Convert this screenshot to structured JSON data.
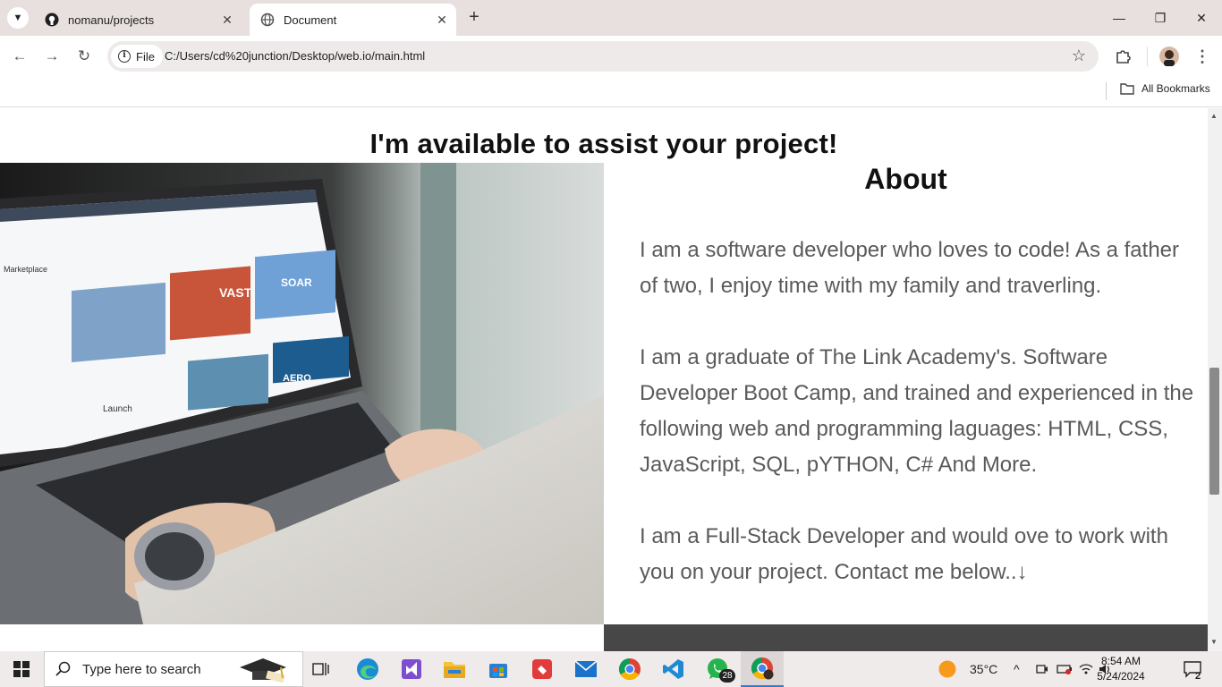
{
  "browser": {
    "tabs": [
      {
        "title": "nomanu/projects",
        "icon": "github-icon",
        "active": false
      },
      {
        "title": "Document",
        "icon": "globe-icon",
        "active": true
      }
    ],
    "address": {
      "scheme_chip": "File",
      "url": "C:/Users/cd%20junction/Desktop/web.io/main.html"
    },
    "bookmarks": {
      "all_label": "All Bookmarks"
    }
  },
  "page": {
    "headline": "I'm available to assist your project!",
    "about": {
      "title": "About",
      "paragraphs": [
        "I am a software developer who loves to code! As a father of two, I enjoy time with my family and traverling.",
        "I am a graduate of The Link Academy's. Software Developer Boot Camp, and trained and experienced in the following web and programming laguages: HTML, CSS, JavaScript, SQL, pYTHON, C# And More.",
        "I am a Full-Stack Developer and would ove to work with you on your project. Contact me below..↓"
      ]
    },
    "photo": {
      "alt": "laptop-marketplace-photo",
      "screen_labels": [
        "Marketplace",
        "VAST",
        "SOAR",
        "AERO",
        "Launch"
      ]
    }
  },
  "taskbar": {
    "search_placeholder": "Type here to search",
    "whatsapp_badge": "28",
    "weather": "35°C",
    "time": "8:54 AM",
    "date": "5/24/2024",
    "notifications": "2"
  },
  "colors": {
    "tab_strip": "#e8e0df",
    "omnibox": "#eeeaea",
    "text_gray": "#5a5a5a",
    "dark_strip": "#474747"
  }
}
